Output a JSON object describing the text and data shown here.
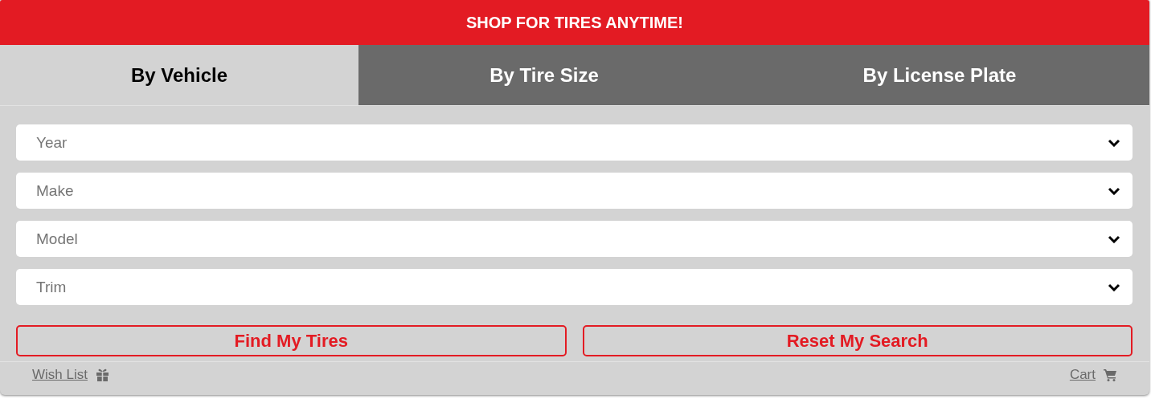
{
  "banner": {
    "title": "SHOP FOR TIRES ANYTIME!"
  },
  "tabs": [
    {
      "label": "By Vehicle",
      "selected": true
    },
    {
      "label": "By Tire Size",
      "selected": false
    },
    {
      "label": "By License Plate",
      "selected": false
    }
  ],
  "fields": [
    {
      "placeholder": "Year"
    },
    {
      "placeholder": "Make"
    },
    {
      "placeholder": "Model"
    },
    {
      "placeholder": "Trim"
    }
  ],
  "buttons": [
    "Find My Tires",
    "Reset My Search"
  ],
  "footer": {
    "wish_list": "Wish List",
    "cart": "Cart"
  }
}
